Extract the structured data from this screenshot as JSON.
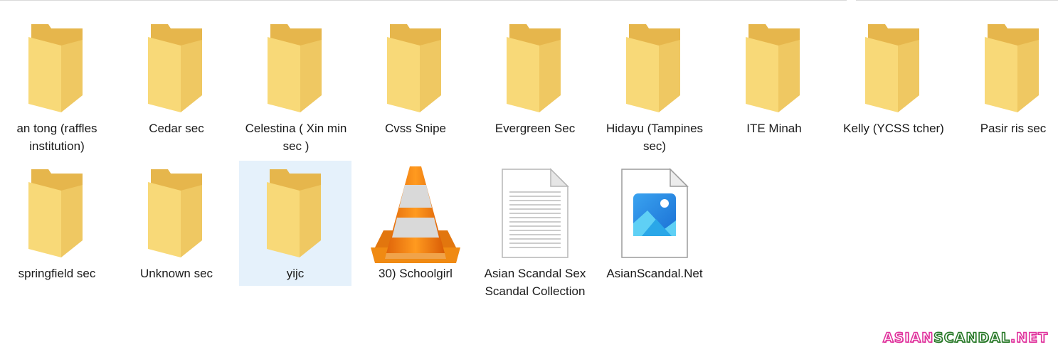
{
  "items": [
    {
      "label": "an tong (raffles institution)",
      "icon": "folder-icon",
      "type": "folder",
      "selected": false
    },
    {
      "label": "Cedar sec",
      "icon": "folder-icon",
      "type": "folder",
      "selected": false
    },
    {
      "label": "Celestina ( Xin min sec )",
      "icon": "folder-icon",
      "type": "folder",
      "selected": false
    },
    {
      "label": "Cvss Snipe",
      "icon": "folder-icon",
      "type": "folder",
      "selected": false
    },
    {
      "label": "Evergreen Sec",
      "icon": "folder-icon",
      "type": "folder",
      "selected": false
    },
    {
      "label": "Hidayu (Tampines sec)",
      "icon": "folder-icon",
      "type": "folder",
      "selected": false
    },
    {
      "label": "ITE Minah",
      "icon": "folder-icon",
      "type": "folder",
      "selected": false
    },
    {
      "label": "Kelly (YCSS tcher)",
      "icon": "folder-icon",
      "type": "folder",
      "selected": false
    },
    {
      "label": "Pasir ris sec",
      "icon": "folder-icon",
      "type": "folder",
      "selected": false
    },
    {
      "label": "springfield sec",
      "icon": "folder-icon",
      "type": "folder",
      "selected": false
    },
    {
      "label": "Unknown sec",
      "icon": "folder-icon",
      "type": "folder",
      "selected": false
    },
    {
      "label": "yijc",
      "icon": "folder-icon",
      "type": "folder",
      "selected": true
    },
    {
      "label": "30) Schoolgirl",
      "icon": "vlc-cone-icon",
      "type": "video",
      "selected": false
    },
    {
      "label": "Asian Scandal Sex Scandal Collection",
      "icon": "text-document-icon",
      "type": "document",
      "selected": false
    },
    {
      "label": "AsianScandal.Net",
      "icon": "image-file-icon",
      "type": "image",
      "selected": false
    }
  ],
  "watermark": {
    "part1": "ASIAN",
    "part2": "SCANDAL",
    "part3": ".NET"
  },
  "colors": {
    "selection": "#e5f1fb",
    "folder": "#f6d576",
    "folder_back": "#e8b94a",
    "vlc_orange": "#f08a12",
    "watermark_pink": "#e0339d",
    "watermark_green": "#2a7a2a"
  }
}
